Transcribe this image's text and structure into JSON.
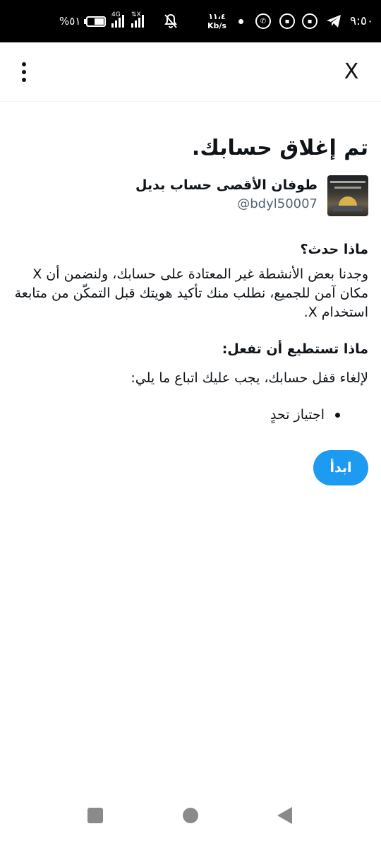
{
  "status_bar": {
    "time": "٩:٥٠",
    "battery_percent": "%٥١",
    "battery_level": 0.51,
    "network_1": "4G",
    "network_2": "⇅X",
    "speed_value": "١١،٤",
    "speed_unit": "Kb/s",
    "icons": [
      "telegram-icon",
      "app-notification-icon",
      "app-notification-icon",
      "whatsapp-icon",
      "dot-icon",
      "mute-icon",
      "signal-icon",
      "battery-icon"
    ]
  },
  "top_bar": {
    "close_label": "X"
  },
  "main": {
    "title": "تم إغلاق حسابك.",
    "account": {
      "name": "طوفان الأقصى حساب بديل",
      "handle": "@bdyl50007"
    },
    "what_happened_heading": "ماذا حدث؟",
    "what_happened_body": "وجدنا بعض الأنشطة غير المعتادة على حسابك، ولنضمن أن X مكان آمن للجميع، نطلب منك تأكيد هويتك قبل التمكّن من متابعة استخدام X.",
    "what_to_do_heading": "ماذا تستطيع أن تفعل:",
    "what_to_do_body": "لإلغاء قفل حسابك، يجب عليك اتباع ما يلي:",
    "steps": [
      "اجتياز تحدٍ"
    ],
    "start_button": "ابدأ"
  },
  "colors": {
    "accent": "#1d9bf0",
    "text": "#0f1419",
    "secondary_text": "#536471"
  }
}
